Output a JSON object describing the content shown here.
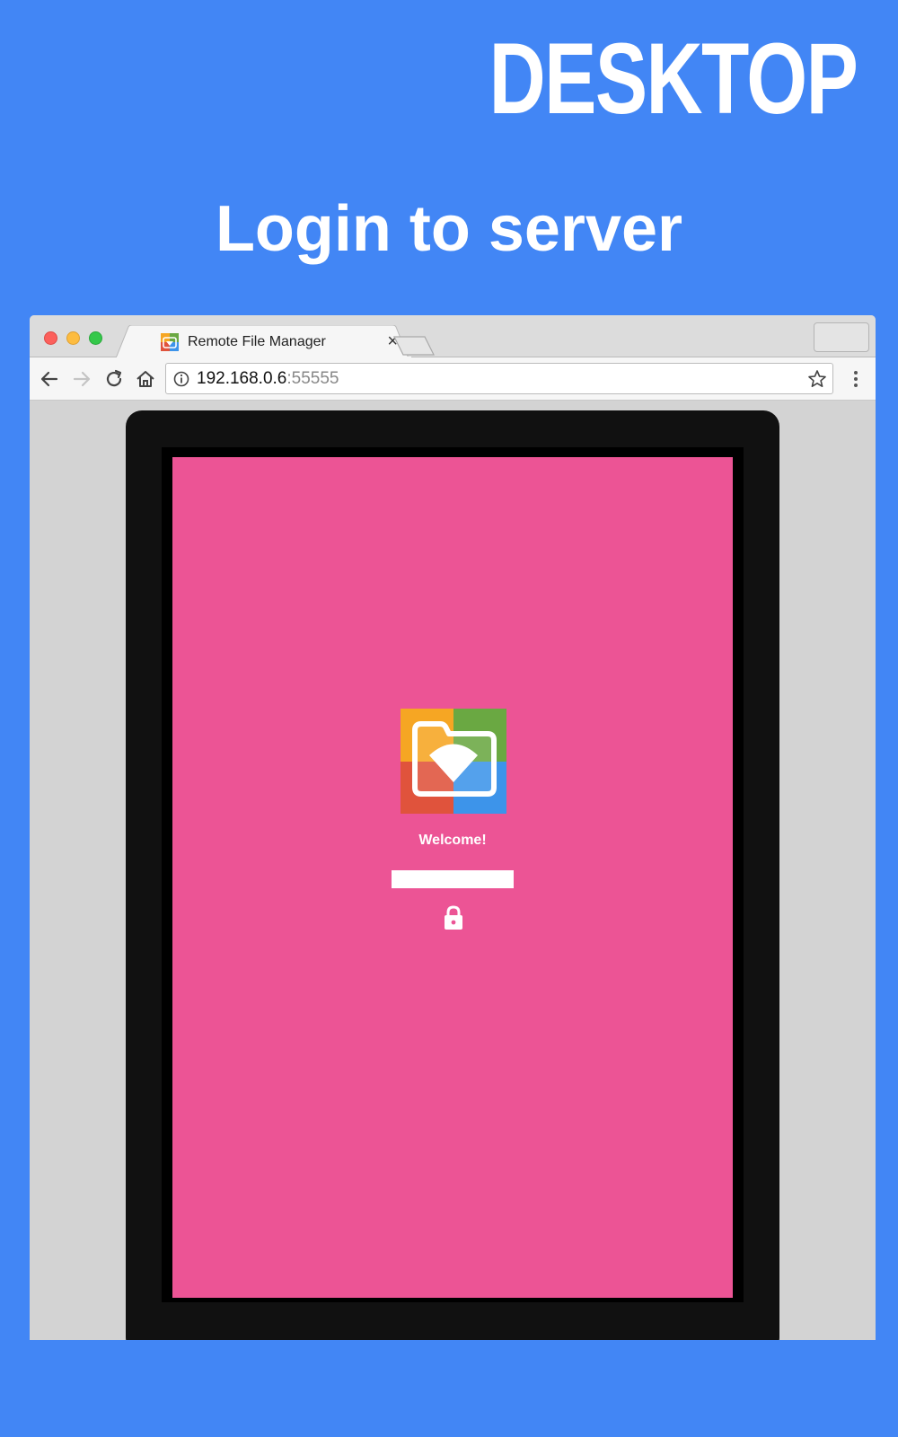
{
  "headline": {
    "platform": "DESKTOP",
    "title": "Login to server"
  },
  "browser": {
    "tab": {
      "title": "Remote File Manager",
      "favicon": "app-logo-icon",
      "close": "×"
    },
    "address_bar": {
      "host": "192.168.0.6",
      "port": ":55555"
    },
    "icons": [
      "back-icon",
      "forward-icon",
      "reload-icon",
      "home-icon",
      "info-icon",
      "star-icon",
      "menu-icon"
    ]
  },
  "app": {
    "welcome_text": "Welcome!",
    "password_input": {
      "value": "",
      "placeholder": ""
    },
    "login_icon": "lock-icon"
  },
  "colors": {
    "page_background": "#4286f5",
    "app_background": "#ec5495",
    "logo_orange": "#f6a623",
    "logo_green": "#6aa842",
    "logo_red": "#e0533c",
    "logo_blue": "#3d94ea"
  }
}
